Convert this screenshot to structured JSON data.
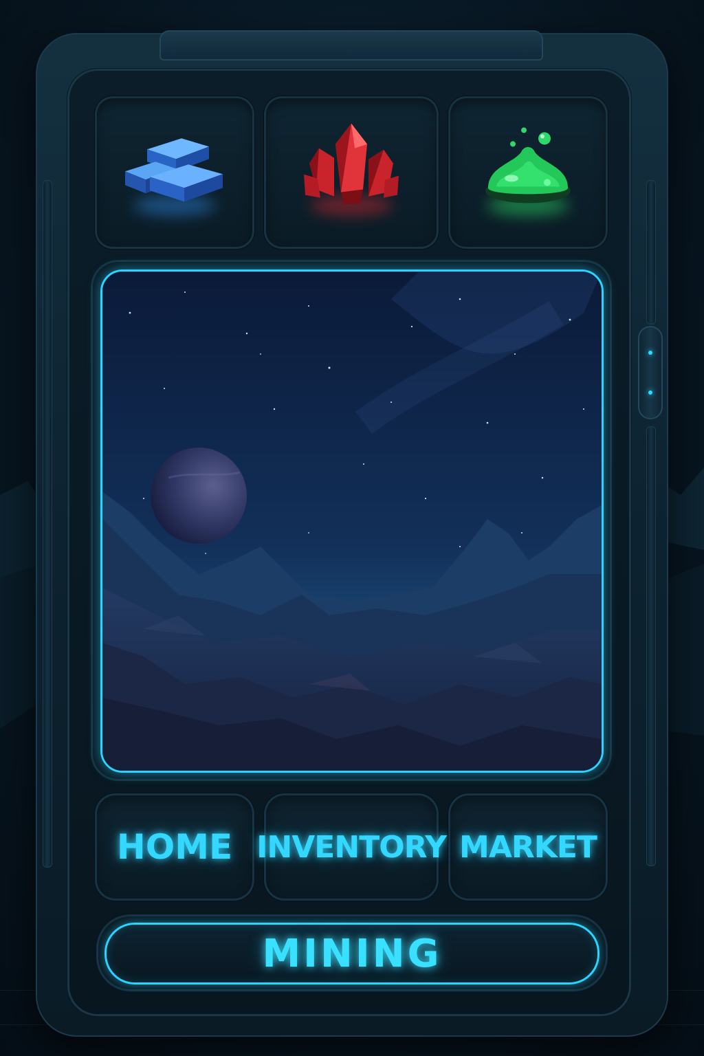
{
  "resources": [
    {
      "name": "ingot-icon",
      "color": "#2f8be8"
    },
    {
      "name": "crystal-icon",
      "color": "#d9272f"
    },
    {
      "name": "slime-icon",
      "color": "#2ee86a"
    }
  ],
  "nav": {
    "home_label": "HOME",
    "inventory_label": "INVENTORY",
    "market_label": "MARKET"
  },
  "action": {
    "mining_label": "MINING"
  },
  "colors": {
    "accent": "#2ad4ff",
    "panel": "#0b1d29"
  }
}
